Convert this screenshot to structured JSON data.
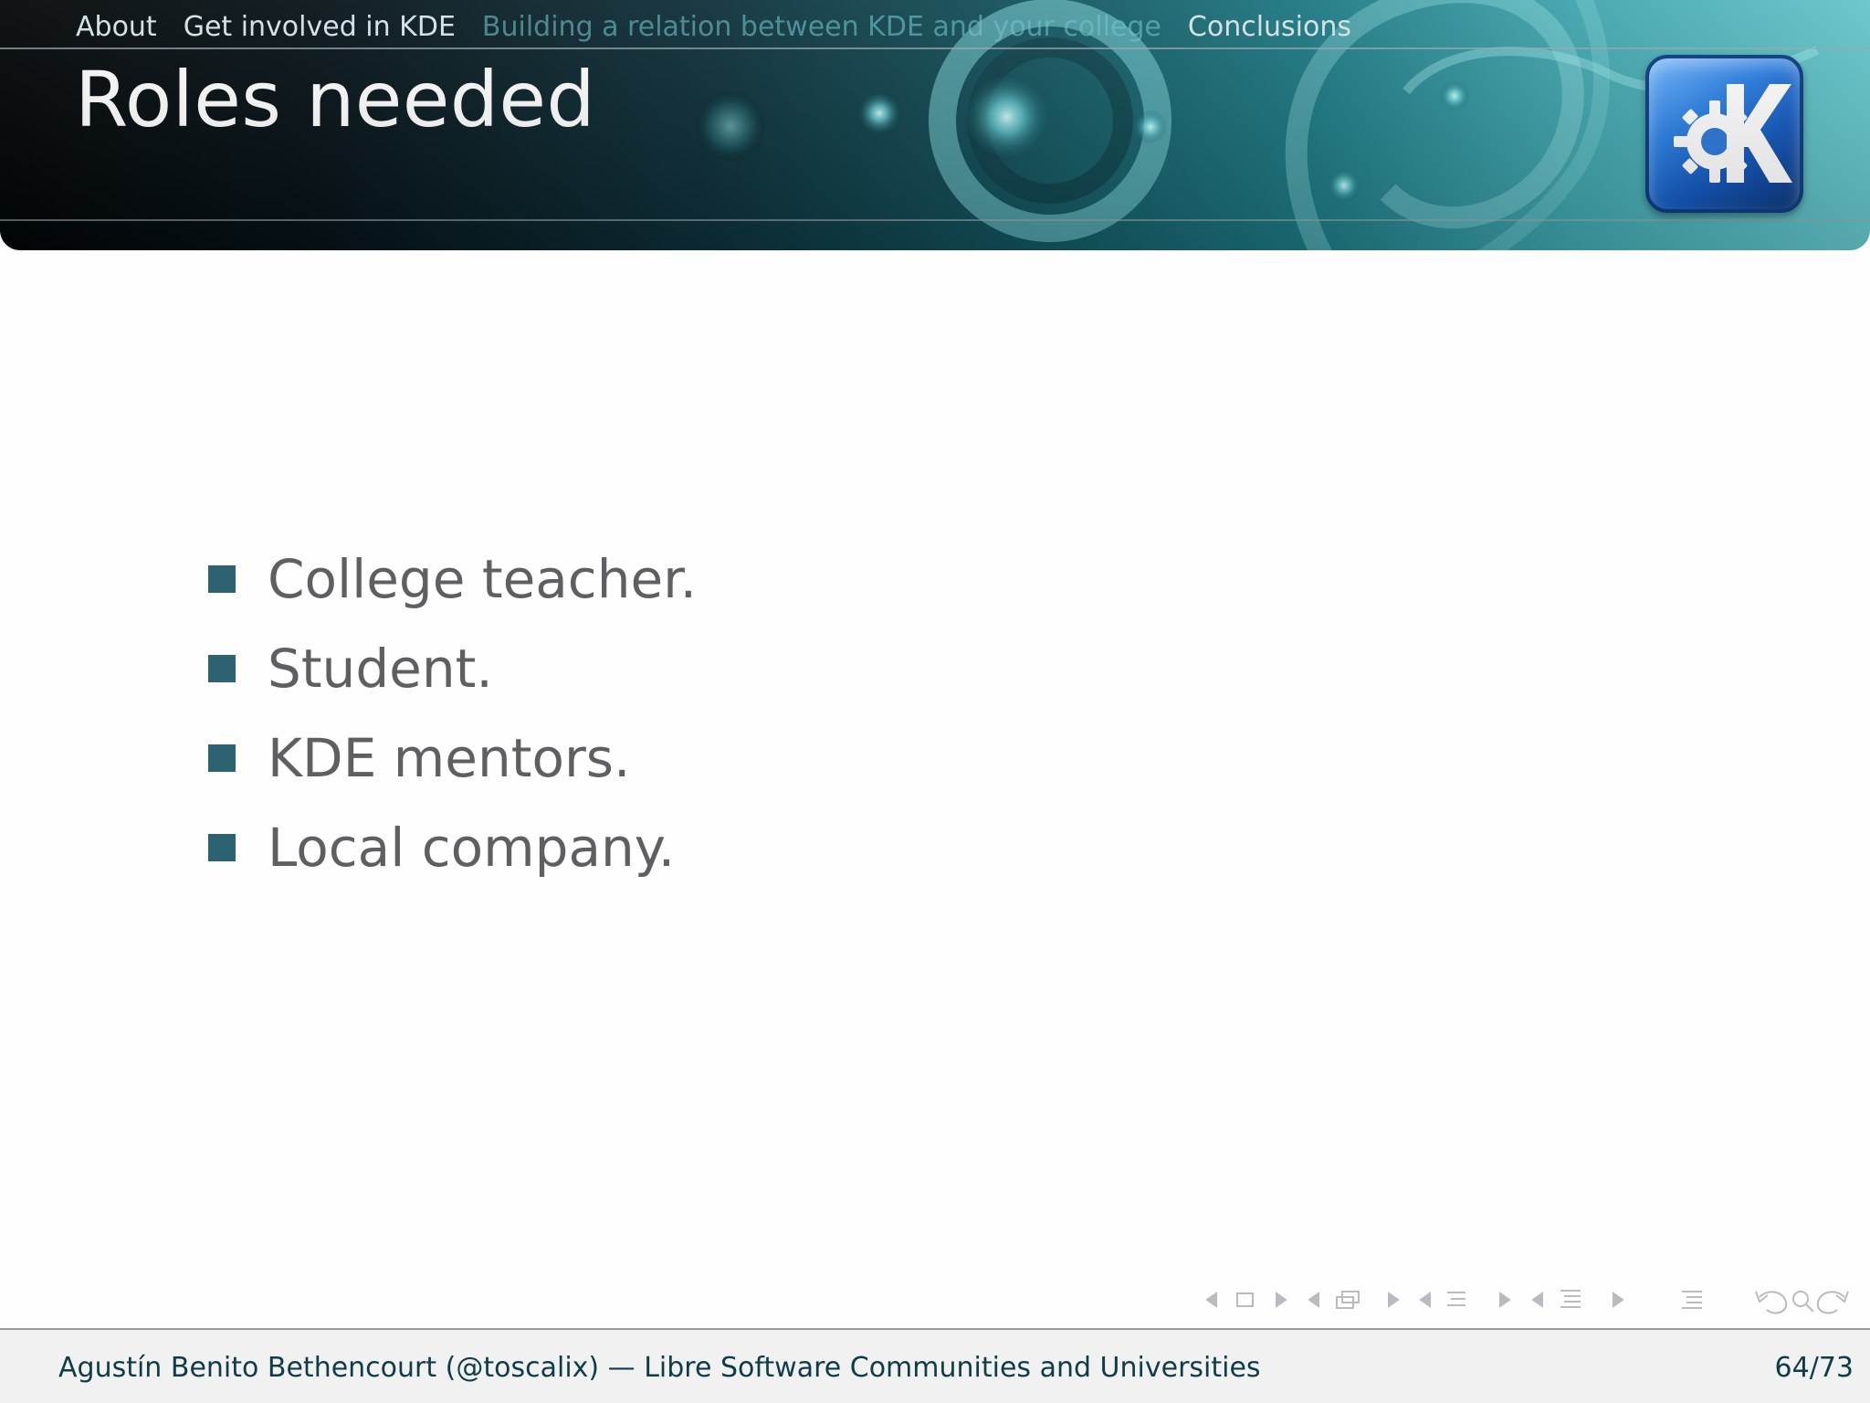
{
  "header": {
    "nav_items": [
      "About",
      "Get involved in KDE",
      "Building a relation between KDE and your college",
      "Conclusions"
    ],
    "title": "Roles needed",
    "logo_icon": "kde-logo-icon"
  },
  "main": {
    "bullets": [
      "College teacher.",
      "Student.",
      "KDE mentors.",
      "Local company."
    ]
  },
  "footer": {
    "text": "Agustín Benito Bethencourt (@toscalix) — Libre Software Communities and Universities",
    "page_number": "64/73"
  },
  "navigation_controls": {
    "icons": [
      "previous-frame-icon",
      "frame-icon",
      "next-frame-icon",
      "previous-subsection-icon",
      "subsection-icon",
      "next-subsection-icon",
      "previous-section-icon",
      "section-icon",
      "next-section-icon",
      "previous-section-list-icon",
      "section-list-icon",
      "next-section-list-icon",
      "menu-icon",
      "undo-icon",
      "search-icon",
      "redo-icon"
    ]
  },
  "colors": {
    "bullet": "#2d6270",
    "footer_text": "#0e3c47",
    "body_text": "#5f5f61",
    "header_text": "#d5e4e8"
  }
}
